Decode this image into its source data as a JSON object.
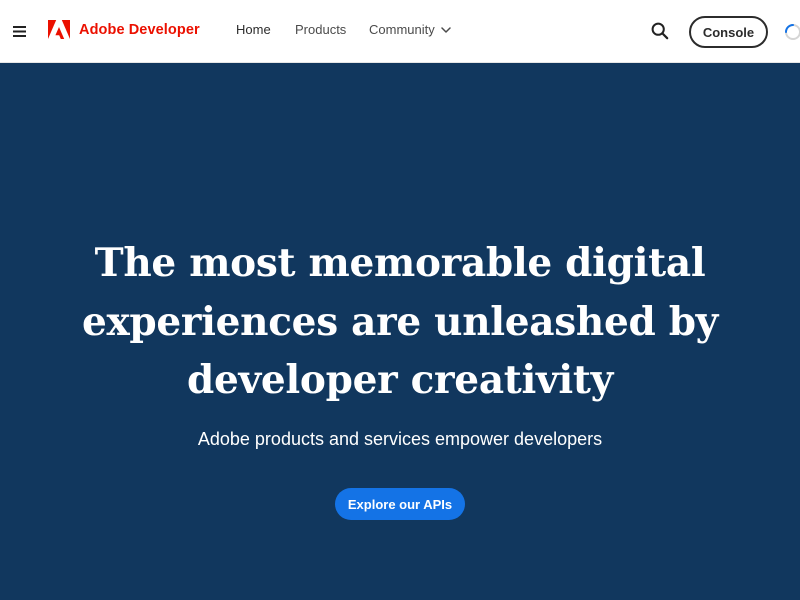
{
  "header": {
    "menu_icon": "hamburger-menu-icon",
    "logo": {
      "icon": "adobe-logo-icon",
      "text": "Adobe Developer",
      "color": "#eb1000"
    },
    "nav": {
      "home": "Home",
      "products": "Products",
      "community": "Community"
    },
    "search_icon": "search-icon",
    "console_label": "Console",
    "spinner_icon": "loading-spinner-icon"
  },
  "hero": {
    "title": "The most memorable digital experiences are unleashed by developer creativity",
    "subtitle": "Adobe products and services empower developers",
    "cta_label": "Explore our APIs",
    "background_color": "#11375e",
    "cta_color": "#1473e6"
  }
}
